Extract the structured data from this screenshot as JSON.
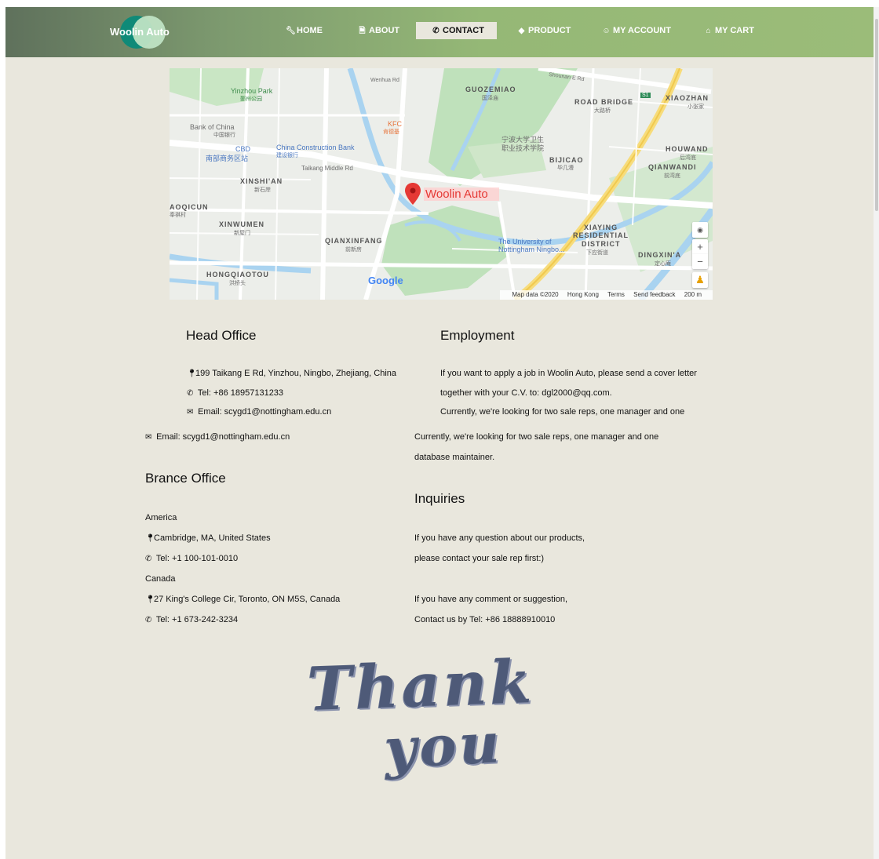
{
  "nav": {
    "logo_text": "Woolin Auto",
    "items": [
      {
        "icon": "wrench-icon",
        "glyph": "🔧",
        "label": "HOME"
      },
      {
        "icon": "file-icon",
        "glyph": "🗎",
        "label": "ABOUT"
      },
      {
        "icon": "phone-icon",
        "glyph": "📞",
        "label": "CONTACT"
      },
      {
        "icon": "tag-icon",
        "glyph": "🏷",
        "label": "PRODUCT"
      },
      {
        "icon": "user-icon",
        "glyph": "☺",
        "label": "MY ACCOUNT"
      },
      {
        "icon": "basket-icon",
        "glyph": "🧺",
        "label": "MY CART"
      }
    ],
    "active": "CONTACT"
  },
  "map": {
    "marker_label": "Woolin Auto",
    "google_logo": "Google",
    "labels": {
      "yinzhou_park": "Yinzhou Park",
      "yinzhou_park_cn": "鄞州公园",
      "guozemiao": "GUOZEMIAO",
      "guozemiao_cn": "国泽庙",
      "road_bridge": "ROAD BRIDGE",
      "road_bridge_cn": "大路桥",
      "xiaozhan": "XIAOZHAN",
      "xiaozhan_cn": "小张家",
      "bank_of_china": "Bank of China",
      "bank_of_china_cn": "中国银行",
      "kfc": "KFC",
      "kfc_cn": "肯德基",
      "ningbo_college": "宁波大学卫生",
      "ningbo_college2": "职业技术学院",
      "cbd": "CBD",
      "cbd_cn": "南部商务区站",
      "ccb": "China Construction Bank",
      "ccb_cn": "建设银行",
      "houwand": "HOUWAND",
      "houwand_cn": "后湾底",
      "bijicao": "BIJICAO",
      "bijicao_cn": "毕几漕",
      "qianwandi": "QIANWANDI",
      "qianwandi_cn": "前湾底",
      "taikang": "Taikang Middle Rd",
      "xinshian": "XINSHI'AN",
      "xinshian_cn": "新石岸",
      "aoqicun": "AOQICUN",
      "aoqicun_cn": "奉祺村",
      "xinwumen": "XINWUMEN",
      "xinwumen_cn": "新屋门",
      "xiaying1": "XIAYING",
      "xiaying2": "RESIDENTIAL",
      "xiaying3": "DISTRICT",
      "xiaying_cn": "下应街道",
      "qianxinfang": "QIANXINFANG",
      "qianxinfang_cn": "前新房",
      "nottingham1": "The University of",
      "nottingham2": "Nottingham Ningbo...",
      "dingxina": "DINGXIN'A",
      "dingxina_cn": "定心庵",
      "hongqiaotou": "HONGQIAOTOU",
      "hongqiaotou_cn": "洪桥头",
      "shounan": "Shounan E Rd",
      "wenhua": "Wenhua Rd",
      "s1": "S1"
    },
    "footer": [
      "Map data ©2020",
      "Hong Kong",
      "Terms",
      "Send feedback",
      "200 m"
    ]
  },
  "head_office": {
    "title": "Head Office",
    "address": "199 Taikang E Rd, Yinzhou, Ningbo, Zhejiang, China",
    "tel": "Tel: +86 18957131233",
    "email": "Email: scygd1@nottingham.edu.cn"
  },
  "employment": {
    "title": "Employment",
    "line1": "If you want to apply a job in Woolin Auto, please send a cover letter",
    "line2": "together with your C.V. to: dgl2000@qq.com.",
    "line3": "Currently, we're looking for two sale reps, one manager and one"
  },
  "overflow": {
    "email": "Email: scygd1@nottingham.edu.cn",
    "line1": "Currently, we're looking for two sale reps, one manager and one",
    "line2": "database maintainer."
  },
  "branch_office": {
    "title": "Brance Office",
    "america": "America",
    "america_address": "Cambridge, MA, United States",
    "america_tel": "Tel: +1 100-101-0010",
    "canada": "Canada",
    "canada_address": "27 King's College Cir, Toronto, ON M5S, Canada",
    "canada_tel": "Tel: +1 673-242-3234"
  },
  "inquiries": {
    "title": "Inquiries",
    "line1": "If you have any question about our products,",
    "line2": "please contact your sale rep first:)",
    "line3": "If you have any comment or suggestion,",
    "line4": "Contact us by Tel: +86 18888910010"
  },
  "thanks": {
    "word1": "Thank",
    "word2": "you"
  },
  "colors": {
    "page_bg": "#e9e7dd",
    "nav_start": "#5f715c",
    "nav_end": "#9bbc79",
    "marker": "#e53935"
  }
}
